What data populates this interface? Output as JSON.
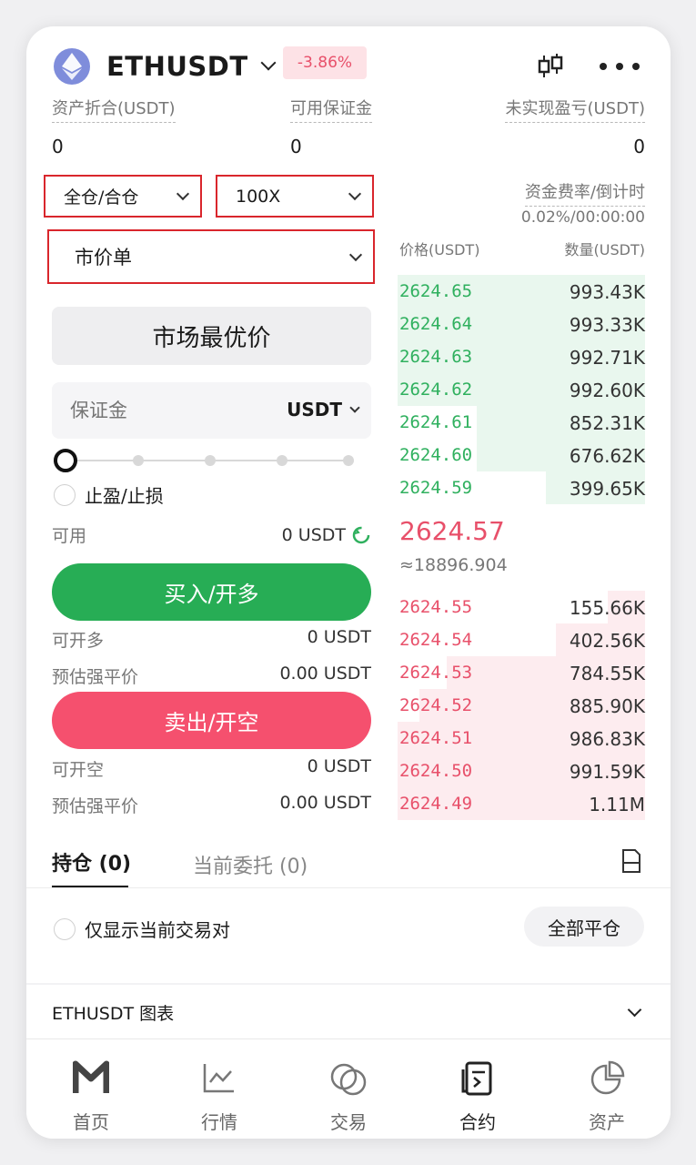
{
  "header": {
    "symbol": "ETHUSDT",
    "change": "-3.86%"
  },
  "stats": {
    "equity_label": "资产折合(USDT)",
    "equity_value": "0",
    "margin_label": "可用保证金",
    "margin_value": "0",
    "pnl_label": "未实现盈亏(USDT)",
    "pnl_value": "0"
  },
  "order_form": {
    "margin_mode": "全仓/合仓",
    "leverage": "100X",
    "order_type": "市价单",
    "price_display": "市场最优价",
    "margin_placeholder": "保证金",
    "margin_unit": "USDT",
    "slider_percent": 0,
    "tpsl_label": "止盈/止损",
    "available_label": "可用",
    "available_value": "0 USDT",
    "buy_label": "买入/开多",
    "can_long_label": "可开多",
    "can_long_value": "0 USDT",
    "liq_label_1": "预估强平价",
    "liq_value_1": "0.00 USDT",
    "sell_label": "卖出/开空",
    "can_short_label": "可开空",
    "can_short_value": "0 USDT",
    "liq_label_2": "预估强平价",
    "liq_value_2": "0.00 USDT"
  },
  "funding": {
    "label": "资金费率/倒计时",
    "value": "0.02%/00:00:00"
  },
  "orderbook": {
    "price_header": "价格(USDT)",
    "qty_header": "数量(USDT)",
    "bids": [
      {
        "price": "2624.65",
        "qty": "993.43K",
        "depth": 1.0
      },
      {
        "price": "2624.64",
        "qty": "993.33K",
        "depth": 1.0
      },
      {
        "price": "2624.63",
        "qty": "992.71K",
        "depth": 1.0
      },
      {
        "price": "2624.62",
        "qty": "992.60K",
        "depth": 1.0
      },
      {
        "price": "2624.61",
        "qty": "852.31K",
        "depth": 0.68
      },
      {
        "price": "2624.60",
        "qty": "676.62K",
        "depth": 0.68
      },
      {
        "price": "2624.59",
        "qty": "399.65K",
        "depth": 0.4
      }
    ],
    "last_price": "2624.57",
    "last_price_cny": "≈18896.904",
    "asks": [
      {
        "price": "2624.55",
        "qty": "155.66K",
        "depth": 0.15
      },
      {
        "price": "2624.54",
        "qty": "402.56K",
        "depth": 0.36
      },
      {
        "price": "2624.53",
        "qty": "784.55K",
        "depth": 0.8
      },
      {
        "price": "2624.52",
        "qty": "885.90K",
        "depth": 0.91
      },
      {
        "price": "2624.51",
        "qty": "986.83K",
        "depth": 1.0
      },
      {
        "price": "2624.50",
        "qty": "991.59K",
        "depth": 1.0
      },
      {
        "price": "2624.49",
        "qty": "1.11M",
        "depth": 1.0
      }
    ]
  },
  "positions": {
    "tab_positions": "持仓 (0)",
    "tab_orders": "当前委托 (0)",
    "filter_label": "仅显示当前交易对",
    "close_all": "全部平仓"
  },
  "chart_section": {
    "label": "ETHUSDT 图表"
  },
  "nav": {
    "home": "首页",
    "market": "行情",
    "trade": "交易",
    "futures": "合约",
    "assets": "资产"
  },
  "colors": {
    "buy": "#27ad55",
    "sell": "#f5506e",
    "bid_bg": "#e9f7ee",
    "ask_bg": "#fdecef"
  }
}
